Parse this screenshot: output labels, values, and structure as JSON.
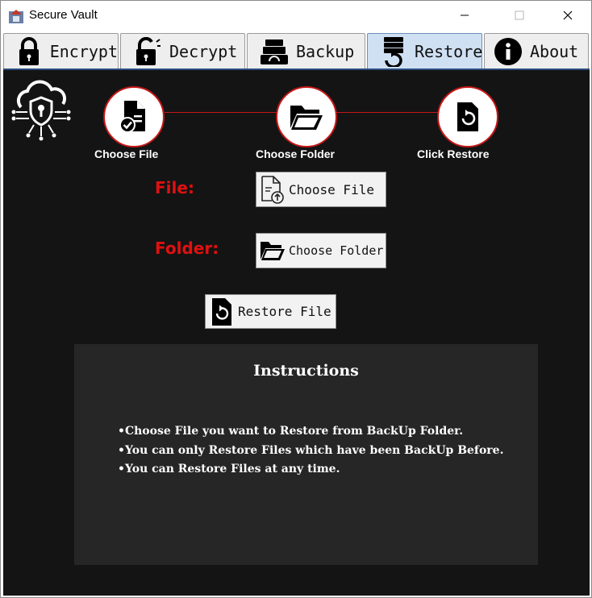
{
  "window": {
    "title": "Secure Vault",
    "controls": {
      "minimize": "—",
      "maximize": "☐",
      "close": "✕"
    }
  },
  "tabs": [
    {
      "label": "Encrypt",
      "icon": "lock-icon",
      "active": false
    },
    {
      "label": "Decrypt",
      "icon": "unlock-icon",
      "active": false
    },
    {
      "label": "Backup",
      "icon": "backup-icon",
      "active": false
    },
    {
      "label": "Restore",
      "icon": "restore-server-icon",
      "active": true
    },
    {
      "label": "About",
      "icon": "info-icon",
      "active": false
    }
  ],
  "steps": [
    {
      "label": "Choose File",
      "icon": "file-check-icon"
    },
    {
      "label": "Choose Folder",
      "icon": "folder-open-icon"
    },
    {
      "label": "Click Restore",
      "icon": "restore-icon"
    }
  ],
  "form": {
    "file_label": "File:",
    "folder_label": "Folder:",
    "choose_file_button": "Choose File",
    "choose_folder_button": "Choose Folder",
    "restore_button": "Restore File"
  },
  "instructions": {
    "title": "Instructions",
    "items": [
      "Choose File you want to Restore from BackUp Folder.",
      "You can only Restore Files which have been BackUp Before.",
      "You can Restore Files at any time."
    ]
  },
  "colors": {
    "content_bg": "#141414",
    "instructions_bg": "#262626",
    "accent_red": "#e01010",
    "step_line": "#c41717",
    "active_tab": "#cfe0f3"
  }
}
